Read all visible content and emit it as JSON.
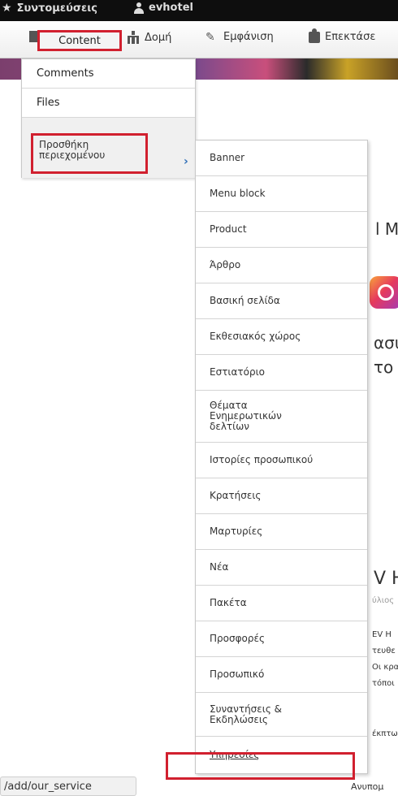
{
  "topbar": {
    "shortcuts_label": "Συντομεύσεις",
    "user_label": "evhotel"
  },
  "toolbar": {
    "content_label": "Content",
    "structure_label": "Δομή",
    "appearance_label": "Εμφάνιση",
    "extend_label": "Επεκτάσε"
  },
  "content_menu": {
    "items": [
      "Comments",
      "Files",
      "Προσθήκη περιεχομένου"
    ]
  },
  "add_content_submenu": {
    "items": [
      "Banner",
      "Menu block",
      "Product",
      "Άρθρο",
      "Βασική σελίδα",
      "Εκθεσιακός χώρος",
      "Εστιατόριο",
      "Θέματα Ενημερωτικών δελτίων",
      "Ιστορίες προσωπικού",
      "Κρατήσεις",
      "Μαρτυρίες",
      "Νέα",
      "Πακέτα",
      "Προσφορές",
      "Προσωπικό",
      "Συναντήσεις & Εκδηλώσεις",
      "Υπηρεσίες"
    ]
  },
  "background_page": {
    "fragment_1": "l Mo",
    "fragment_2": "ασυ",
    "fragment_3": "το δ",
    "fragment_4": "V H",
    "fragment_5": "ύλιος",
    "fragment_6": "EV H",
    "fragment_7": "τευθε",
    "fragment_8": "Οι κρα",
    "fragment_9": "τόποι",
    "fragment_10": "έκπτω",
    "fragment_11": "Ανυπομ"
  },
  "statusbar": {
    "url_text": "/add/our_service"
  },
  "colors": {
    "highlight": "#d1202f",
    "arrow": "#2f6fb7"
  }
}
